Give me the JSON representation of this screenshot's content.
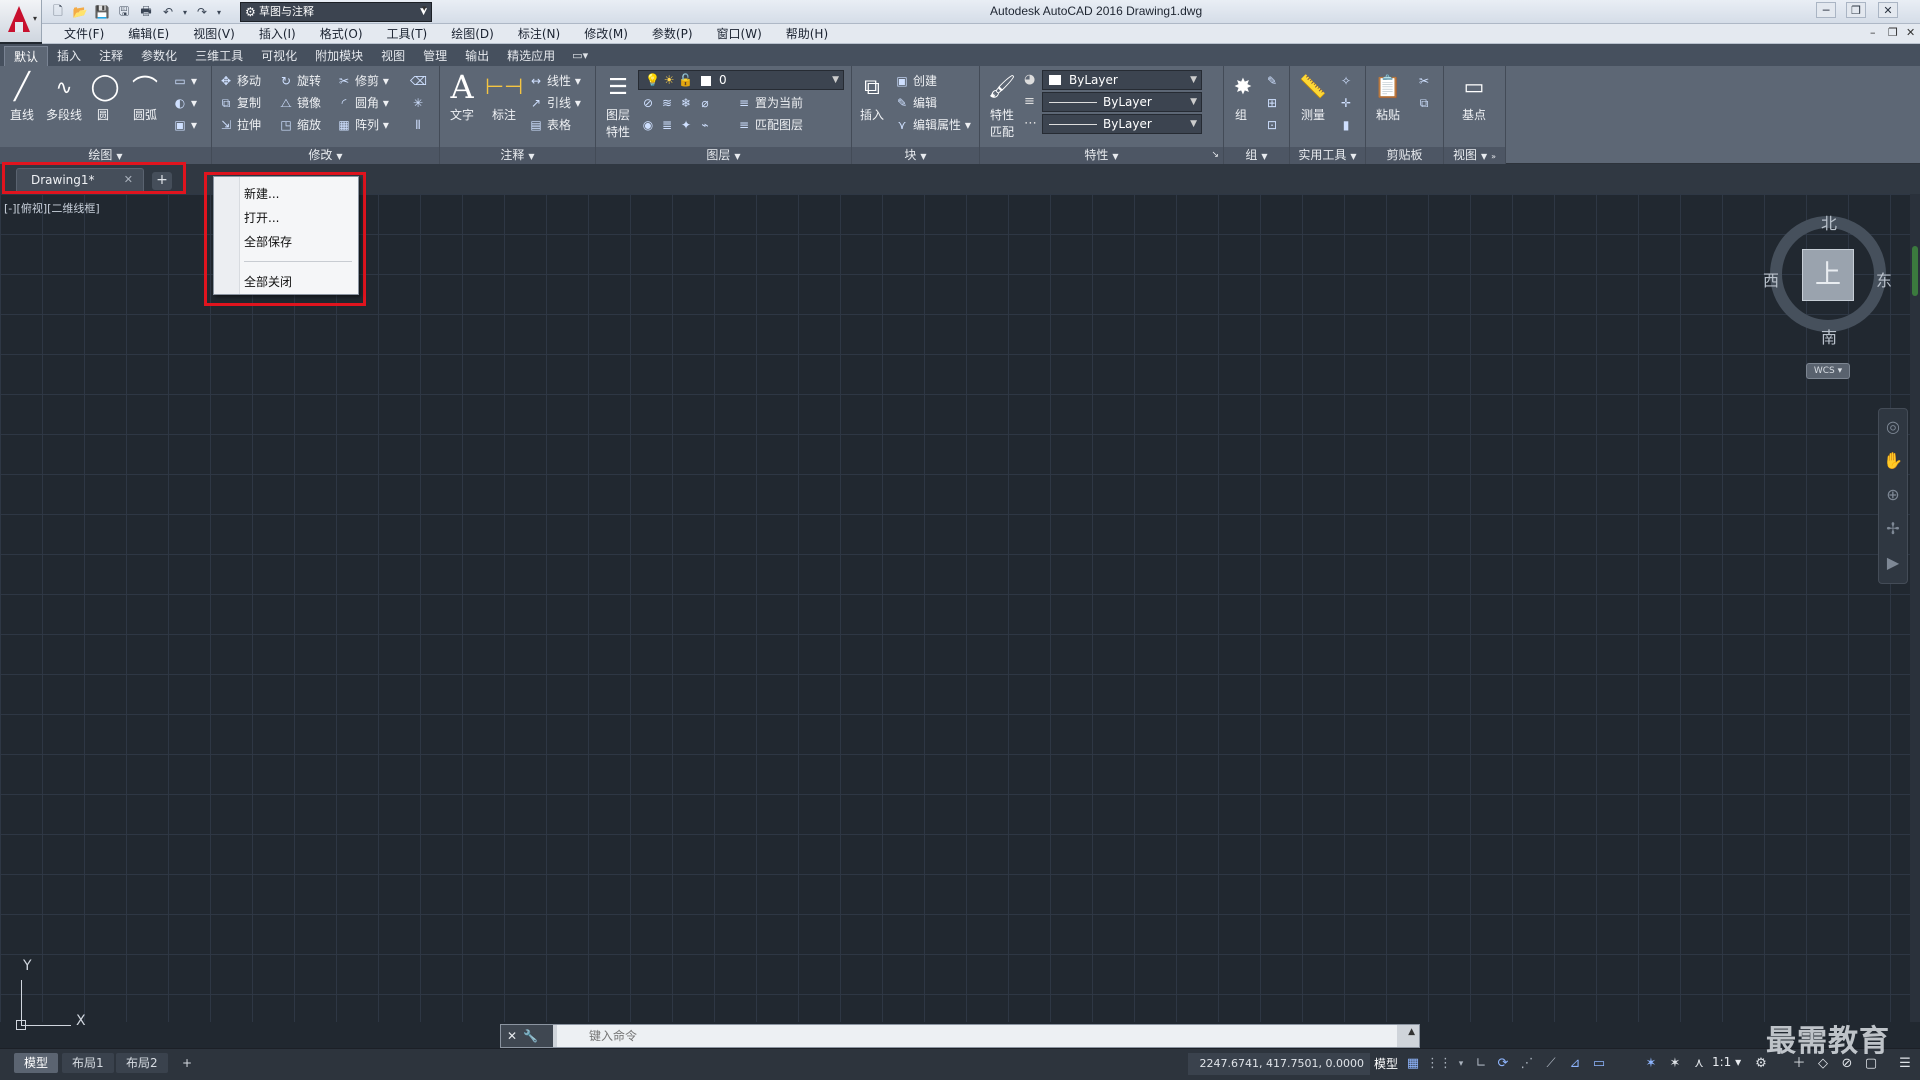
{
  "window": {
    "title": "Autodesk AutoCAD 2016    Drawing1.dwg",
    "workspace": "草图与注释"
  },
  "menu": [
    "文件(F)",
    "编辑(E)",
    "视图(V)",
    "插入(I)",
    "格式(O)",
    "工具(T)",
    "绘图(D)",
    "标注(N)",
    "修改(M)",
    "参数(P)",
    "窗口(W)",
    "帮助(H)"
  ],
  "ribbon_tabs": [
    "默认",
    "插入",
    "注释",
    "参数化",
    "三维工具",
    "可视化",
    "附加模块",
    "视图",
    "管理",
    "输出",
    "精选应用"
  ],
  "ribbon": {
    "draw": {
      "title": "绘图",
      "line": "直线",
      "polyline": "多段线",
      "circle": "圆",
      "arc": "圆弧"
    },
    "modify": {
      "title": "修改",
      "move": "移动",
      "rotate": "旋转",
      "trim": "修剪",
      "copy": "复制",
      "mirror": "镜像",
      "fillet": "圆角",
      "stretch": "拉伸",
      "scale": "缩放",
      "array": "阵列"
    },
    "annotation": {
      "title": "注释",
      "text": "文字",
      "dimension": "标注",
      "linear": "线性",
      "leader": "引线",
      "table": "表格"
    },
    "layers": {
      "title": "图层",
      "layer_props_1": "图层",
      "layer_props_2": "特性",
      "current_layer": "0",
      "set_current": "置为当前",
      "match_layer": "匹配图层"
    },
    "block": {
      "title": "块",
      "insert": "插入",
      "create": "创建",
      "edit": "编辑",
      "edit_attr": "编辑属性"
    },
    "properties": {
      "title": "特性",
      "match_1": "特性",
      "match_2": "匹配",
      "color": "ByLayer",
      "linetype": "ByLayer",
      "lineweight": "ByLayer"
    },
    "groups": {
      "title": "组",
      "group": "组"
    },
    "utilities": {
      "title": "实用工具",
      "measure": "测量"
    },
    "clipboard": {
      "title": "剪贴板",
      "paste": "粘贴"
    },
    "view": {
      "title": "视图",
      "base": "基点"
    }
  },
  "doc_tab": {
    "name": "Drawing1*"
  },
  "context_menu": {
    "items": [
      "新建...",
      "打开...",
      "全部保存",
      "全部关闭"
    ]
  },
  "viewport_label": "[-][俯视][二维线框]",
  "viewcube": {
    "north": "北",
    "south": "南",
    "east": "东",
    "west": "西",
    "face": "上",
    "wcs": "WCS"
  },
  "ucs": {
    "x": "X",
    "y": "Y"
  },
  "command": {
    "placeholder": "键入命令"
  },
  "status": {
    "tabs": [
      "模型",
      "布局1",
      "布局2"
    ],
    "coords": "2247.6741, 417.7501, 0.0000",
    "space": "模型",
    "scale": "1:1"
  },
  "watermark": "最需教育"
}
